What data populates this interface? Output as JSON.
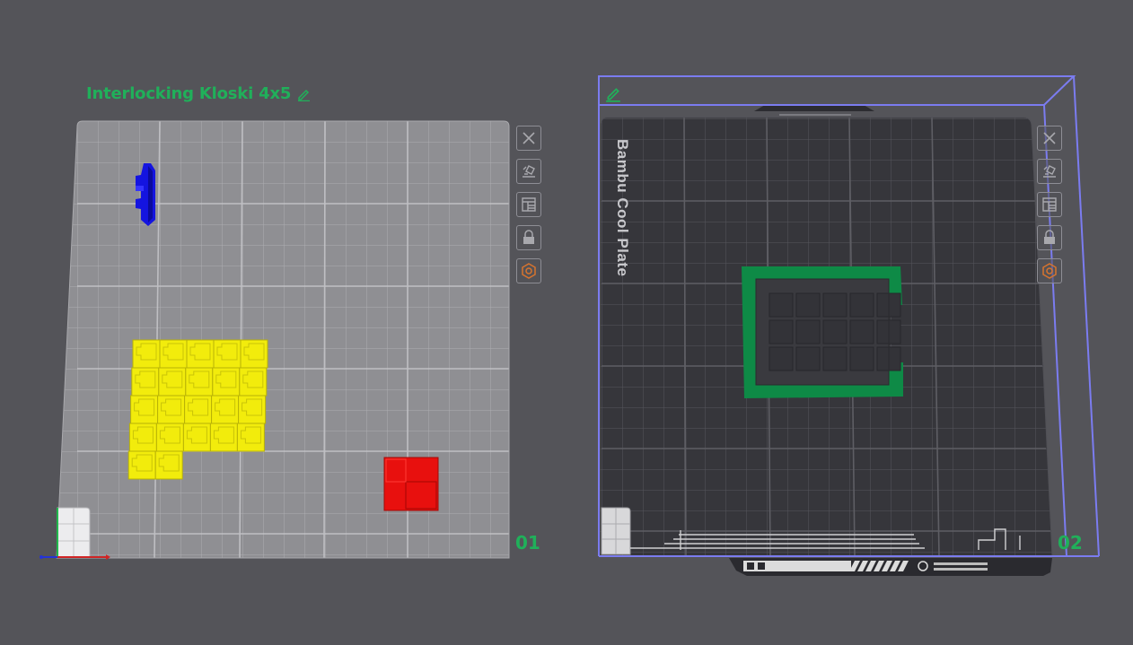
{
  "plates": [
    {
      "name": "Interlocking Kloski 4x5",
      "number": "01"
    },
    {
      "name": "",
      "number": "02",
      "plate_type": "Bambu Cool Plate"
    }
  ],
  "toolbar_icons": [
    "close-icon",
    "auto-orient-icon",
    "arrange-icon",
    "lock-icon",
    "plate-settings-icon"
  ],
  "colors": {
    "background": "#545459",
    "accent_green": "#20b05a",
    "object_blue": "#1414e0",
    "object_yellow": "#f2ec0c",
    "object_red": "#e8100e",
    "frame_green": "#0e8a46",
    "selection_outline": "#7b7cf0",
    "settings_orange": "#d8742e"
  }
}
